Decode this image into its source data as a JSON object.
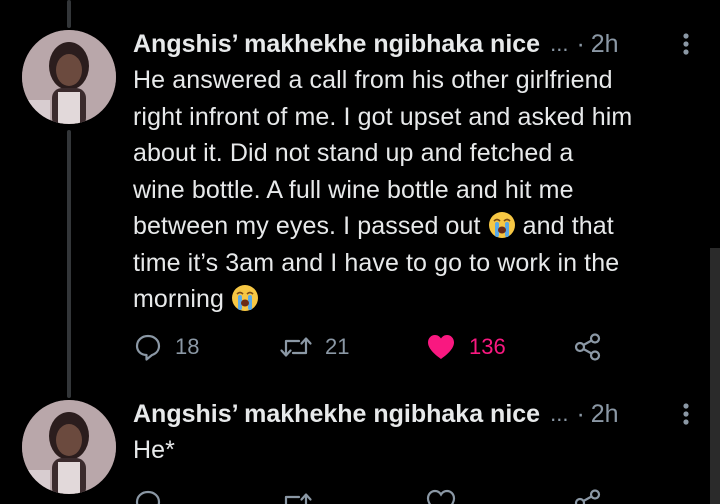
{
  "colors": {
    "background": "#000000",
    "text": "#e7e9ea",
    "muted": "#8b98a5",
    "like": "#f91880",
    "thread_line": "#333639"
  },
  "tweets": [
    {
      "display_name": "Angshis’ makhekhe ngibhaka nice",
      "ellipsis": "...",
      "separator": "·",
      "time": "2h",
      "text_part1": "He answered a call from his other girlfriend\nright infront of me. I got upset and asked him\nabout it. Did not stand up and fetched a\nwine bottle. A full wine bottle and hit me\nbetween my eyes. I passed out ",
      "text_part2": " and that\ntime it’s 3am and I have to go to work in the\nmorning ",
      "emoji": "loudly-crying-face",
      "reply_count": "18",
      "retweet_count": "21",
      "like_count": "136",
      "liked": true
    },
    {
      "display_name": "Angshis’ makhekhe ngibhaka nice",
      "ellipsis": "...",
      "separator": "·",
      "time": "2h",
      "text": "He*"
    }
  ],
  "icons": {
    "reply": "reply-icon",
    "retweet": "retweet-icon",
    "like": "heart-icon",
    "share": "share-icon",
    "more": "more-icon"
  }
}
